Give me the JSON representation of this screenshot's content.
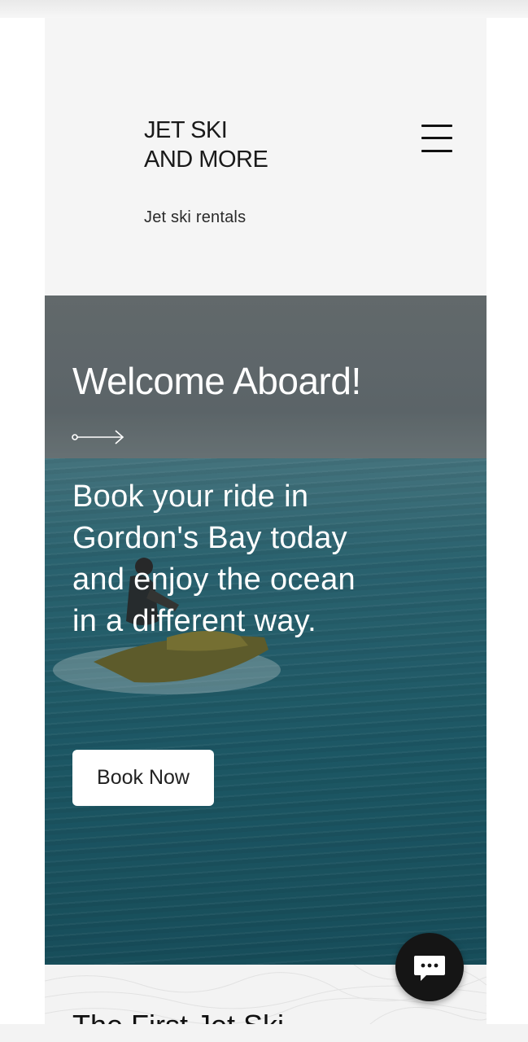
{
  "header": {
    "brand_name": "JET SKI AND MORE",
    "tagline": "Jet ski rentals",
    "menu_icon": "hamburger-menu-icon"
  },
  "hero": {
    "title": "Welcome Aboard!",
    "arrow_icon": "arrow-right-icon",
    "body": "Book your ride  in Gordon's Bay today and enjoy the ocean in a different way.",
    "cta_label": "Book Now"
  },
  "next_section": {
    "heading_partial": "The First Jet Ski"
  },
  "chat": {
    "icon": "chat-bubble-icon"
  },
  "colors": {
    "header_bg": "#f5f5f5",
    "button_bg": "#ffffff",
    "chat_bg": "#151515",
    "sea": "#1f6574"
  }
}
